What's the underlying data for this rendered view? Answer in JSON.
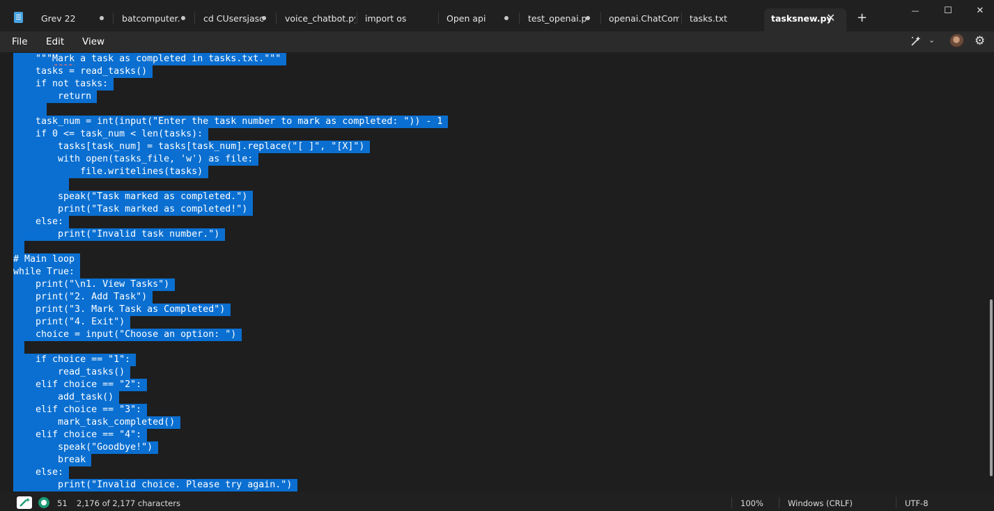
{
  "tabs": [
    {
      "label": "Grev 22",
      "modified": true
    },
    {
      "label": "batcomputer.",
      "modified": true
    },
    {
      "label": "cd CUsersjasc",
      "modified": true
    },
    {
      "label": "voice_chatbot.py",
      "modified": false
    },
    {
      "label": "import os",
      "modified": false
    },
    {
      "label": "Open api",
      "modified": true
    },
    {
      "label": "test_openai.p",
      "modified": true
    },
    {
      "label": "openai.ChatComple",
      "modified": false
    },
    {
      "label": "tasks.txt",
      "modified": false
    },
    {
      "label": "tasksnew.py",
      "modified": false,
      "active": true
    }
  ],
  "window": {
    "close_tab": "✕",
    "new_tab": "+",
    "minimize": "—",
    "maximize": "☐",
    "close": "✕"
  },
  "menu": {
    "file": "File",
    "edit": "Edit",
    "view": "View"
  },
  "toolbar": {
    "copilot_icon": "copilot-icon",
    "chevron": "⌄",
    "settings": "⚙"
  },
  "code": [
    "    \"\"\"Mark a task as completed in tasks.txt.\"\"\"",
    "    tasks = read_tasks()",
    "    if not tasks:",
    "        return",
    "     ",
    "    task_num = int(input(\"Enter the task number to mark as completed: \")) - 1",
    "    if 0 <= task_num < len(tasks):",
    "        tasks[task_num] = tasks[task_num].replace(\"[ ]\", \"[X]\")",
    "        with open(tasks_file, 'w') as file:",
    "            file.writelines(tasks)",
    "         ",
    "        speak(\"Task marked as completed.\")",
    "        print(\"Task marked as completed!\")",
    "    else:",
    "        print(\"Invalid task number.\")",
    " ",
    "# Main loop",
    "while True:",
    "    print(\"\\n1. View Tasks\")",
    "    print(\"2. Add Task\")",
    "    print(\"3. Mark Task as Completed\")",
    "    print(\"4. Exit\")",
    "    choice = input(\"Choose an option: \")",
    " ",
    "    if choice == \"1\":",
    "        read_tasks()",
    "    elif choice == \"2\":",
    "        add_task()",
    "    elif choice == \"3\":",
    "        mark_task_completed()",
    "    elif choice == \"4\":",
    "        speak(\"Goodbye!\")",
    "        break",
    "    else:",
    "        print(\"Invalid choice. Please try again.\")"
  ],
  "status": {
    "line_number": "51",
    "char_count": "2,176 of 2,177 characters",
    "zoom": "100%",
    "line_ending": "Windows (CRLF)",
    "encoding": "UTF-8"
  },
  "colors": {
    "selection": "#0a6fd1",
    "background": "#1e1e1e"
  }
}
